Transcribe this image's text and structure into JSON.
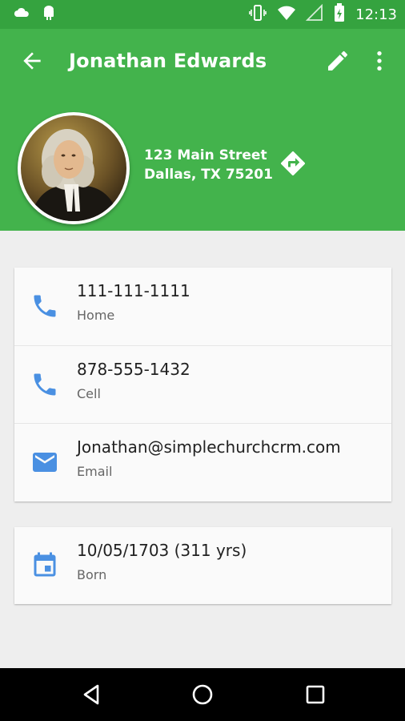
{
  "status_bar": {
    "time": "12:13",
    "icons": [
      "weather-icon",
      "android-icon",
      "vibrate-icon",
      "wifi-icon",
      "signal-icon",
      "battery-icon"
    ]
  },
  "header": {
    "title": "Jonathan Edwards",
    "address_line1": "123 Main Street",
    "address_line2": "Dallas, TX 75201",
    "colors": {
      "status": "#35a33f",
      "appbar": "#43b34c"
    }
  },
  "contact": [
    {
      "value": "111-111-1111",
      "label": "Home",
      "icon": "phone-icon"
    },
    {
      "value": "878-555-1432",
      "label": "Cell",
      "icon": "phone-icon"
    },
    {
      "value": "Jonathan@simplechurchcrm.com",
      "label": "Email",
      "icon": "email-icon"
    }
  ],
  "born": {
    "value": "10/05/1703 (311 yrs)",
    "label": "Born",
    "icon": "calendar-icon"
  },
  "icon_color": "#4a90e2"
}
